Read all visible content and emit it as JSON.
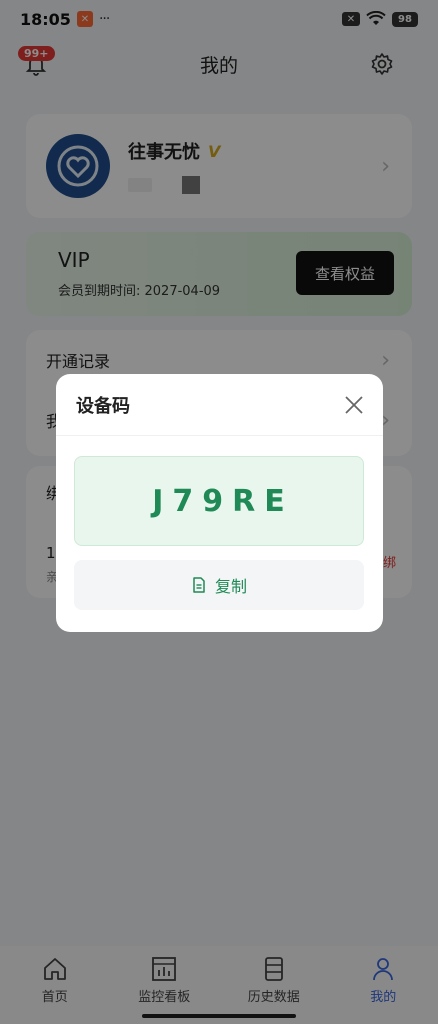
{
  "status_bar": {
    "time": "18:05",
    "dots": "···",
    "battery": "98"
  },
  "header": {
    "title": "我的",
    "badge": "99+"
  },
  "profile": {
    "name": "往事无忧",
    "vip_mark": "V"
  },
  "vip": {
    "title": "VIP",
    "expire_label": "会员到期时间: 2027-04-09",
    "button": "查看权益"
  },
  "list": {
    "items": [
      {
        "label": "开通记录"
      },
      {
        "label": "我"
      }
    ]
  },
  "bind": {
    "title": "绑",
    "row_value": "1",
    "row_sub": "亲",
    "unbind": "绑"
  },
  "dialog": {
    "title": "设备码",
    "code": "J79RE",
    "copy_label": "复制"
  },
  "nav": {
    "items": [
      {
        "label": "首页"
      },
      {
        "label": "监控看板"
      },
      {
        "label": "历史数据"
      },
      {
        "label": "我的"
      }
    ]
  },
  "colors": {
    "accent_green": "#1f8a55",
    "nav_active": "#3a66e0",
    "badge_red": "#e53935"
  }
}
